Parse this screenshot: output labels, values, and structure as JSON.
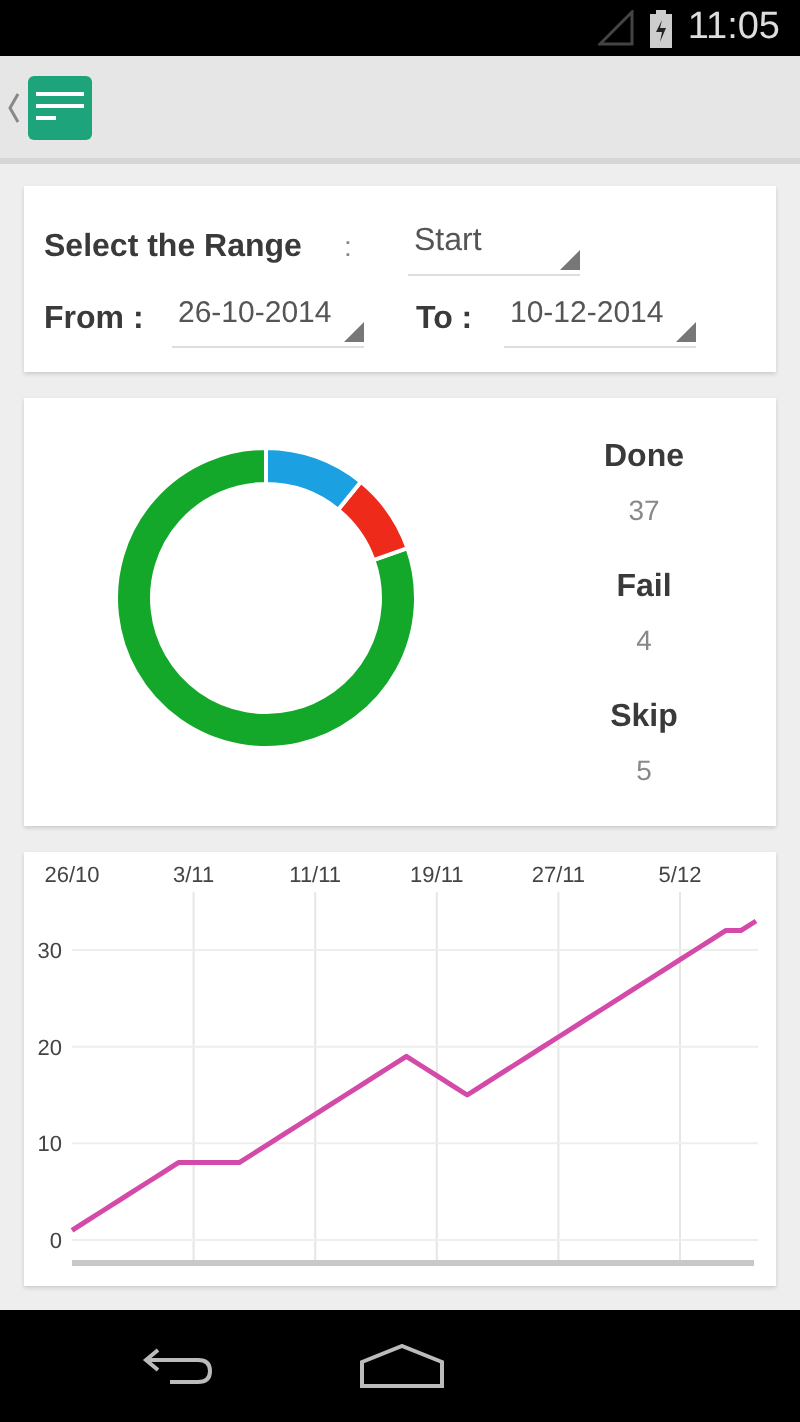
{
  "status_bar": {
    "time": "11:05"
  },
  "range_card": {
    "range_label": "Select the Range",
    "separator": ":",
    "range_value": "Start",
    "from_label": "From :",
    "from_value": "26-10-2014",
    "to_label": "To :",
    "to_value": "10-12-2014"
  },
  "summary_card": {
    "chart_data": {
      "type": "donut",
      "values": [
        80.4,
        8.7,
        10.9
      ],
      "colors": [
        "#13a829",
        "#ee2a1b",
        "#1ba1e2"
      ]
    },
    "stats": [
      {
        "label": "Done",
        "value": "37"
      },
      {
        "label": "Fail",
        "value": "4"
      },
      {
        "label": "Skip",
        "value": "5"
      }
    ]
  },
  "trend_card": {
    "chart_data": {
      "type": "line",
      "categories": [
        "26/10",
        null,
        null,
        null,
        null,
        null,
        null,
        null,
        "3/11",
        null,
        null,
        null,
        null,
        null,
        null,
        null,
        "11/11",
        null,
        null,
        null,
        null,
        null,
        null,
        null,
        "19/11",
        null,
        null,
        null,
        null,
        null,
        null,
        null,
        "27/11",
        null,
        null,
        null,
        null,
        null,
        null,
        null,
        "5/12",
        null,
        null,
        null,
        null,
        null
      ],
      "series": [
        {
          "color": "#d44aa8",
          "values": [
            1,
            2,
            3,
            4,
            5,
            6,
            7,
            8,
            8,
            8,
            8,
            8,
            9,
            10,
            11,
            12,
            13,
            14,
            15,
            16,
            17,
            18,
            19,
            18,
            17,
            16,
            15,
            16,
            17,
            18,
            19,
            20,
            21,
            22,
            23,
            24,
            25,
            26,
            27,
            28,
            29,
            30,
            31,
            32,
            32,
            33
          ]
        }
      ],
      "ylim": [
        0,
        36
      ],
      "yticks": [
        0,
        10,
        20,
        30
      ],
      "grid": true
    }
  }
}
